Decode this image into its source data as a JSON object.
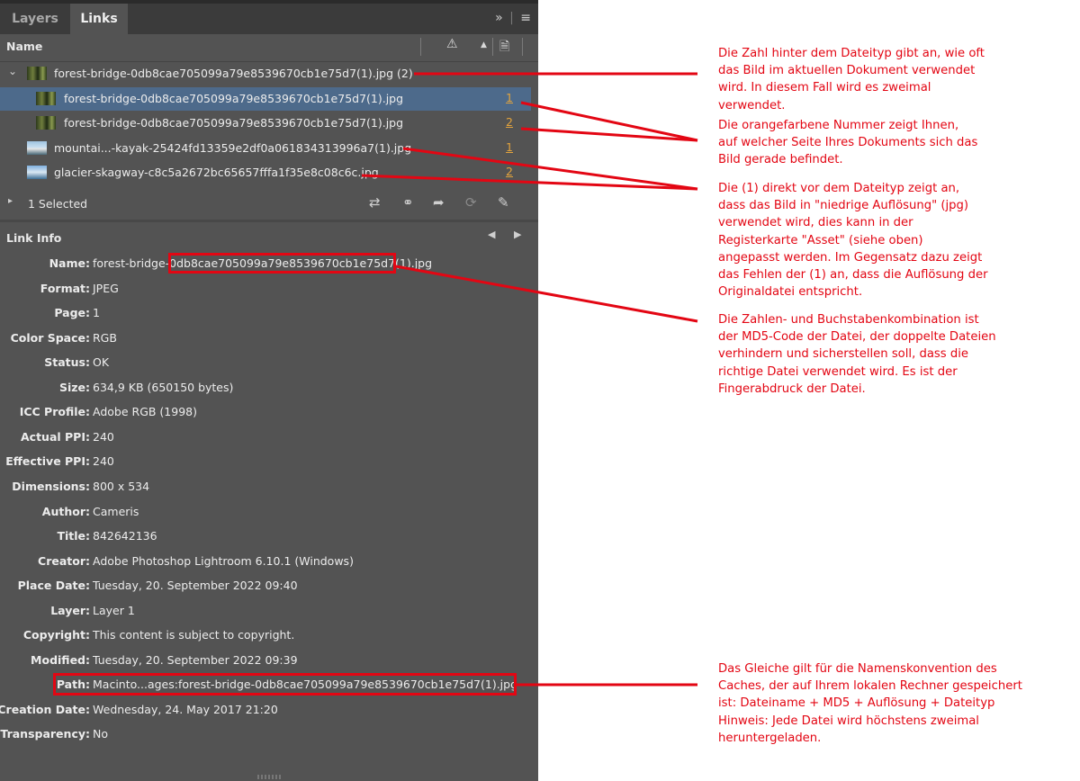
{
  "tabs": [
    {
      "label": "Layers",
      "active": false
    },
    {
      "label": "Links",
      "active": true
    }
  ],
  "header": {
    "name_label": "Name"
  },
  "links": [
    {
      "name": "forest-bridge-0db8cae705099a79e8539670cb1e75d7(1).jpg (2)",
      "page": "",
      "parent": true,
      "thumb": "forest"
    },
    {
      "name": "forest-bridge-0db8cae705099a79e8539670cb1e75d7(1).jpg",
      "page": "1",
      "selected": true,
      "thumb": "forest"
    },
    {
      "name": "forest-bridge-0db8cae705099a79e8539670cb1e75d7(1).jpg",
      "page": "2",
      "thumb": "forest"
    },
    {
      "name": "mountai...-kayak-25424fd13359e2df0a061834313996a7(1).jpg",
      "page": "1",
      "thumb": "mountain"
    },
    {
      "name": "glacier-skagway-c8c5a2672bc65657fffa1f35e8c08c6c.jpg",
      "page": "2",
      "thumb": "glacier"
    }
  ],
  "selection": {
    "label": "1 Selected"
  },
  "link_info": {
    "title": "Link Info",
    "rows": [
      {
        "k": "Name:",
        "v": "forest-bridge-0db8cae705099a79e8539670cb1e75d7(1).jpg"
      },
      {
        "k": "Format:",
        "v": "JPEG"
      },
      {
        "k": "Page:",
        "v": "1"
      },
      {
        "k": "Color Space:",
        "v": "RGB"
      },
      {
        "k": "Status:",
        "v": "OK"
      },
      {
        "k": "Size:",
        "v": "634,9 KB (650150 bytes)"
      },
      {
        "k": "ICC Profile:",
        "v": "Adobe RGB (1998)"
      },
      {
        "k": "Actual PPI:",
        "v": "240"
      },
      {
        "k": "Effective PPI:",
        "v": "240"
      },
      {
        "k": "Dimensions:",
        "v": "800 x 534"
      },
      {
        "k": "Author:",
        "v": "Cameris"
      },
      {
        "k": "Title:",
        "v": "842642136"
      },
      {
        "k": "Creator:",
        "v": "Adobe Photoshop Lightroom 6.10.1 (Windows)"
      },
      {
        "k": "Place Date:",
        "v": "Tuesday, 20. September 2022 09:40"
      },
      {
        "k": "Layer:",
        "v": "Layer 1"
      },
      {
        "k": "Copyright:",
        "v": "This content is subject to copyright."
      },
      {
        "k": "Modified:",
        "v": "Tuesday, 20. September 2022 09:39"
      },
      {
        "k": "Path:",
        "v": "Macinto...ages:forest-bridge-0db8cae705099a79e8539670cb1e75d7(1).jpg"
      },
      {
        "k": "Creation Date:",
        "v": "Wednesday, 24. May 2017 21:20"
      },
      {
        "k": "Transparency:",
        "v": "No"
      }
    ]
  },
  "annotations": [
    "Die Zahl hinter dem Dateityp gibt an, wie oft das Bild im aktuellen Dokument verwendet wird. In diesem Fall wird es zweimal verwendet.",
    "Die orangefarbene Nummer zeigt Ihnen, auf welcher Seite Ihres Dokuments sich das Bild gerade befindet.",
    "Die (1) direkt vor dem Dateityp zeigt an, dass das Bild in \"niedrige Auflösung\" (jpg) verwendet wird, dies kann in der Registerkarte \"Asset\" (siehe oben) angepasst werden. Im Gegensatz dazu zeigt das Fehlen der (1) an, dass die Auflösung der Originaldatei entspricht.",
    "Die Zahlen- und Buchstabenkombination ist der MD5-Code der Datei, der doppelte Dateien verhindern und sicherstellen soll, dass die richtige Datei verwendet wird. Es ist der Fingerabdruck der Datei.",
    "Das Gleiche gilt für die Namenskonvention des Caches, der auf Ihrem lokalen Rechner gespeichert ist: Dateiname + MD5 + Auflösung + Dateityp Hinweis: Jede Datei wird höchstens zweimal heruntergeladen."
  ],
  "colors": {
    "accent_red": "#e30613",
    "page_orange": "#e2a33d",
    "panel_bg": "#535353",
    "selection_blue": "#4d6a8b"
  },
  "icons": [
    "expand-panels-icon",
    "panel-menu-icon",
    "warning-icon",
    "sort-arrow-icon",
    "page-icon",
    "chevron-down-icon",
    "relink-from-cc-icon",
    "relink-icon",
    "go-to-link-icon",
    "update-link-icon",
    "edit-original-icon",
    "prev-arrow-icon",
    "next-arrow-icon"
  ]
}
